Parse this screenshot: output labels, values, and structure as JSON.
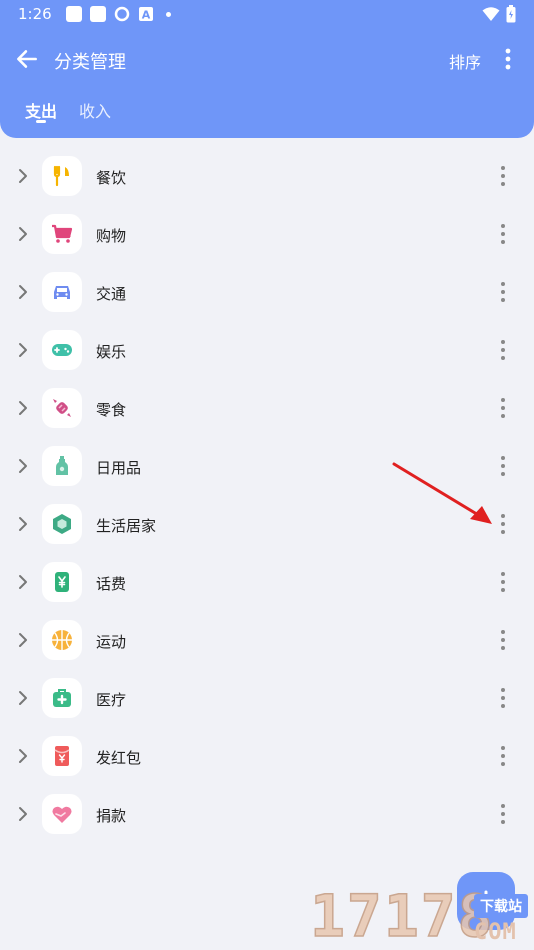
{
  "status_bar": {
    "time": "1:26"
  },
  "toolbar": {
    "title": "分类管理",
    "sort_label": "排序"
  },
  "tabs": [
    {
      "label": "支出",
      "active": true
    },
    {
      "label": "收入",
      "active": false
    }
  ],
  "categories": [
    {
      "label": "餐饮",
      "icon": "fork-knife-icon",
      "color": "#f6b400"
    },
    {
      "label": "购物",
      "icon": "shopping-cart-icon",
      "color": "#e0457b"
    },
    {
      "label": "交通",
      "icon": "car-icon",
      "color": "#6f8cf0"
    },
    {
      "label": "娱乐",
      "icon": "gamepad-icon",
      "color": "#3fc0a8"
    },
    {
      "label": "零食",
      "icon": "candy-icon",
      "color": "#d04f87"
    },
    {
      "label": "日用品",
      "icon": "bottle-icon",
      "color": "#62c2a5"
    },
    {
      "label": "生活居家",
      "icon": "cube-icon",
      "color": "#3daa85"
    },
    {
      "label": "话费",
      "icon": "phone-yen-icon",
      "color": "#2fb27a"
    },
    {
      "label": "运动",
      "icon": "basketball-icon",
      "color": "#f7b23b"
    },
    {
      "label": "医疗",
      "icon": "medkit-icon",
      "color": "#3bbb88"
    },
    {
      "label": "发红包",
      "icon": "red-envelope-icon",
      "color": "#ef5b5b"
    },
    {
      "label": "捐款",
      "icon": "heart-hand-icon",
      "color": "#f07aa0"
    }
  ],
  "watermark": {
    "digits": "17178",
    "tag": "下载站",
    "domain": "COM"
  },
  "colors": {
    "header": "#6f96f8",
    "background": "#f1f2f7",
    "annotation_arrow": "#e02020"
  }
}
